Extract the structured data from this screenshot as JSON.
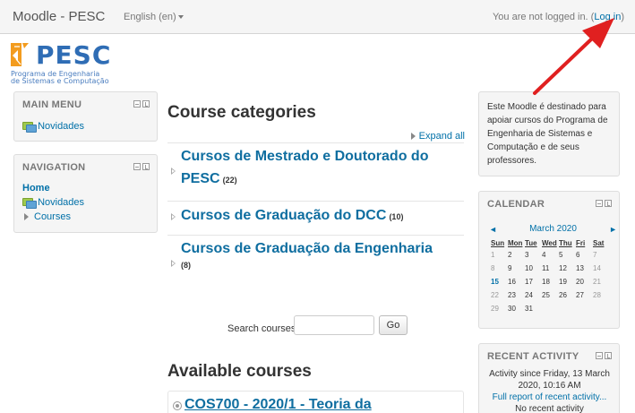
{
  "navbar": {
    "brand": "Moodle - PESC",
    "language": "English (en)",
    "login_prefix": "You are not logged in. (",
    "login_link": "Log in",
    "login_suffix": ")"
  },
  "logo": {
    "text": "PESC",
    "subtitle_line1": "Programa de Engenharia",
    "subtitle_line2": "de Sistemas e Computação"
  },
  "main_menu": {
    "title": "MAIN MENU",
    "items": [
      {
        "label": "Novidades",
        "icon": "forum-icon"
      }
    ]
  },
  "navigation": {
    "title": "NAVIGATION",
    "home": "Home",
    "items": [
      {
        "label": "Novidades",
        "icon": "forum-icon"
      },
      {
        "label": "Courses",
        "icon": "triangle-right-icon"
      }
    ]
  },
  "main": {
    "heading": "Course categories",
    "expand_all": "Expand all",
    "categories": [
      {
        "line1": "Cursos de Mestrado e Doutorado do",
        "line2": "PESC",
        "count": "(22)"
      },
      {
        "line1": "Cursos de Graduação do DCC",
        "line2": "",
        "count": "(10)"
      },
      {
        "line1": "Cursos de Graduação da Engenharia",
        "line2": "",
        "count": "(8)"
      }
    ],
    "search_label": "Search courses:",
    "search_value": "",
    "go_button": "Go",
    "available_heading": "Available courses",
    "first_course": "COS700 - 2020/1 - Teoria da"
  },
  "info_block": {
    "text": "Este Moodle é destinado para apoiar cursos do Programa de Engenharia de Sistemas e Computação e de seus professores."
  },
  "calendar": {
    "title": "CALENDAR",
    "month": "March 2020",
    "prev": "◄",
    "next": "►",
    "weekdays": [
      "Sun",
      "Mon",
      "Tue",
      "Wed",
      "Thu",
      "Fri",
      "Sat"
    ],
    "weeks": [
      [
        "1",
        "2",
        "3",
        "4",
        "5",
        "6",
        "7"
      ],
      [
        "8",
        "9",
        "10",
        "11",
        "12",
        "13",
        "14"
      ],
      [
        "15",
        "16",
        "17",
        "18",
        "19",
        "20",
        "21"
      ],
      [
        "22",
        "23",
        "24",
        "25",
        "26",
        "27",
        "28"
      ],
      [
        "29",
        "30",
        "31",
        "",
        "",
        "",
        ""
      ]
    ],
    "highlight_day": "15"
  },
  "recent_activity": {
    "title": "RECENT ACTIVITY",
    "since_line1": "Activity since Friday, 13 March",
    "since_line2": "2020, 10:16 AM",
    "full_report": "Full report of recent activity...",
    "partial": "No recent activity"
  },
  "colors": {
    "link": "#0070a8",
    "arrow": "#e02020"
  }
}
